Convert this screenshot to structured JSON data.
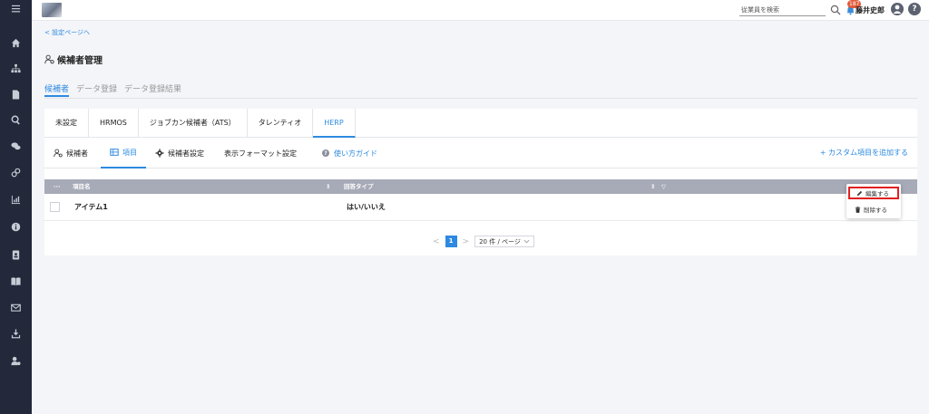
{
  "header": {
    "search_placeholder": "従業員を検索",
    "notification_count": "187",
    "user_name": "藤井史郎",
    "help_glyph": "?"
  },
  "back_link": "< 設定ページへ",
  "page_title": "候補者管理",
  "main_tabs": [
    {
      "label": "候補者",
      "active": true
    },
    {
      "label": "データ登録",
      "active": false
    },
    {
      "label": "データ登録結果",
      "active": false
    }
  ],
  "ats_tabs": [
    {
      "label": "未設定",
      "active": false
    },
    {
      "label": "HRMOS",
      "active": false
    },
    {
      "label": "ジョブカン候補者（ATS）",
      "active": false
    },
    {
      "label": "タレンティオ",
      "active": false
    },
    {
      "label": "HERP",
      "active": true
    }
  ],
  "sub_tabs": {
    "candidates": "候補者",
    "items": "項目",
    "candidate_settings": "候補者設定",
    "display_format": "表示フォーマット設定",
    "guide": "使い方ガイド",
    "add_custom": "+ カスタム項目を追加する"
  },
  "table": {
    "columns": [
      "項目名",
      "回答タイプ"
    ],
    "rows": [
      {
        "name": "アイテム1",
        "type": "はい/いいえ"
      }
    ]
  },
  "pagination": {
    "prev": "<",
    "current_page": "1",
    "next": ">",
    "page_size": "20 件 / ページ"
  },
  "row_menu": {
    "edit": "編集する",
    "delete": "削除する"
  },
  "colors": {
    "accent": "#2d8ae0",
    "sidebar": "#23283a",
    "table_header": "#a7aab7",
    "highlight": "#e02020"
  }
}
